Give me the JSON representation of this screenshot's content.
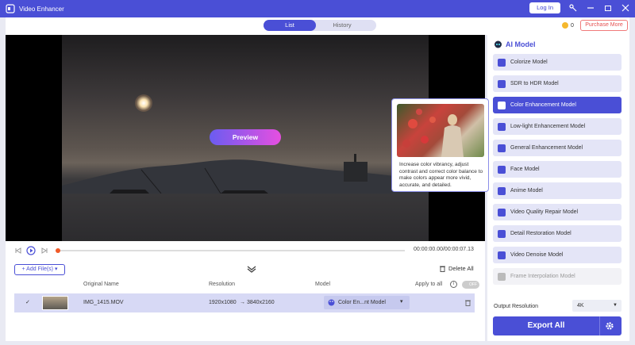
{
  "window": {
    "title": "Video Enhancer",
    "login_label": "Log In"
  },
  "tabs": [
    {
      "label": "List"
    },
    {
      "label": "History"
    }
  ],
  "account": {
    "credits": "0",
    "purchase_label": "Purchase More"
  },
  "preview": {
    "button_label": "Preview"
  },
  "player": {
    "timecode": "00:00:00.00/00:00:07.13",
    "progress": 0
  },
  "file_toolbar": {
    "add_label": "Add File(s)",
    "delete_all_label": "Delete All"
  },
  "table": {
    "headers": {
      "original_name": "Original Name",
      "resolution": "Resolution",
      "model": "Model",
      "apply_all": "Apply to all",
      "toggle": "OFF"
    },
    "rows": [
      {
        "name": "IMG_1415.MOV",
        "res_from": "1920x1080",
        "arrow": "→",
        "res_to": "3840x2160",
        "model": "Color En...nt Model"
      }
    ]
  },
  "ai_panel": {
    "title": "AI Model",
    "models": [
      {
        "label": "Colorize Model",
        "icon": "colorize-icon",
        "state": "normal"
      },
      {
        "label": "SDR to HDR Model",
        "icon": "hdr-icon",
        "state": "normal"
      },
      {
        "label": "Color Enhancement Model",
        "icon": "palette-icon",
        "state": "active"
      },
      {
        "label": "Low-light Enhancement Model",
        "icon": "moon-icon",
        "state": "normal"
      },
      {
        "label": "General Enhancement Model",
        "icon": "play-star-icon",
        "state": "normal"
      },
      {
        "label": "Face Model",
        "icon": "face-icon",
        "state": "normal"
      },
      {
        "label": "Anime Model",
        "icon": "anime-icon",
        "state": "normal"
      },
      {
        "label": "Video Quality Repair Model",
        "icon": "repair-icon",
        "state": "normal"
      },
      {
        "label": "Detail Restoration Model",
        "icon": "detail-icon",
        "state": "normal"
      },
      {
        "label": "Video Denoise Model",
        "icon": "denoise-icon",
        "state": "normal"
      },
      {
        "label": "Frame Interpolation Model",
        "icon": "frames-icon",
        "state": "disabled"
      }
    ],
    "output_resolution_label": "Output Resolution",
    "output_resolution_value": "4K",
    "export_label": "Export All"
  },
  "tooltip": {
    "text": "Increase color vibrancy, adjust contrast and correct color balance to make colors appear more vivid, accurate, and detailed."
  },
  "colors": {
    "accent": "#4a4fd6",
    "purchase": "#e55050"
  }
}
